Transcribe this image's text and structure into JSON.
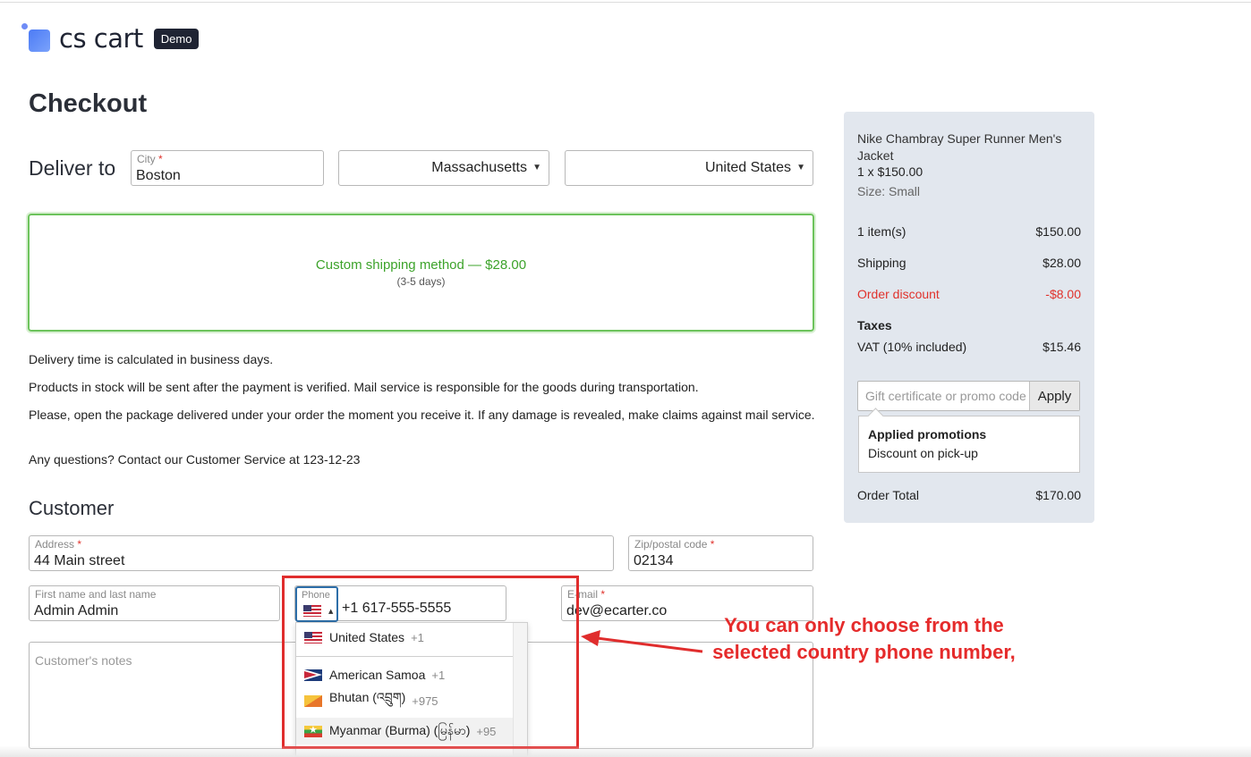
{
  "brand": {
    "name": "cs cart",
    "badge": "Demo"
  },
  "page": {
    "title": "Checkout"
  },
  "delivery": {
    "label": "Deliver to",
    "city": {
      "label": "City",
      "required_mark": "*",
      "value": "Boston"
    },
    "state": {
      "value": "Massachusetts"
    },
    "country": {
      "value": "United States"
    }
  },
  "shipping": {
    "method": "Custom shipping method — $28.00",
    "days": "(3-5 days)"
  },
  "notes": [
    "Delivery time is calculated in business days.",
    "Products in stock will be sent after the payment is verified. Mail service is responsible for the goods during transportation.",
    "Please, open the package delivered under your order the moment you receive it. If any damage is revealed, make claims against mail service.",
    "Any questions? Contact our Customer Service at 123-12-23"
  ],
  "customer": {
    "section_title": "Customer",
    "address": {
      "label": "Address",
      "required_mark": "*",
      "value": "44 Main street"
    },
    "zip": {
      "label": "Zip/postal code",
      "required_mark": "*",
      "value": "02134"
    },
    "name": {
      "label": "First name and last name",
      "value": "Admin Admin"
    },
    "phone": {
      "label": "Phone",
      "value": "+1 617-555-5555"
    },
    "email": {
      "label": "E-mail",
      "required_mark": "*",
      "value": "dev@ecarter.co"
    },
    "notes_placeholder": "Customer's notes"
  },
  "phone_dropdown": {
    "preferred": {
      "name": "United States",
      "code": "+1",
      "flag": "us-flag"
    },
    "items": [
      {
        "name": "American Samoa",
        "code": "+1",
        "flag": "as-flag"
      },
      {
        "name": "Bhutan (འབྲུག)",
        "code": "+975",
        "flag": "bt-flag"
      },
      {
        "name": "Myanmar (Burma) (မြန်မာ)",
        "code": "+95",
        "flag": "mm-flag"
      }
    ]
  },
  "annotation": {
    "text": "You can only choose from the selected country phone number,",
    "color": "#e52b2b"
  },
  "summary": {
    "product_name": "Nike Chambray Super Runner Men's Jacket",
    "product_qty": "1 x $150.00",
    "product_size": "Size: Small",
    "items_label": "1 item(s)",
    "items_value": "$150.00",
    "shipping_label": "Shipping",
    "shipping_value": "$28.00",
    "discount_label": "Order discount",
    "discount_value": "-$8.00",
    "taxes_title": "Taxes",
    "vat_label": "VAT (10% included)",
    "vat_value": "$15.46",
    "promo_placeholder": "Gift certificate or promo code",
    "apply_label": "Apply",
    "applied_title": "Applied promotions",
    "applied_value": "Discount on pick-up",
    "total_label": "Order Total",
    "total_value": "$170.00"
  },
  "colors": {
    "accent_green": "#3da32b",
    "error_red": "#e0322c",
    "panel_bg": "#e2e7ee"
  }
}
